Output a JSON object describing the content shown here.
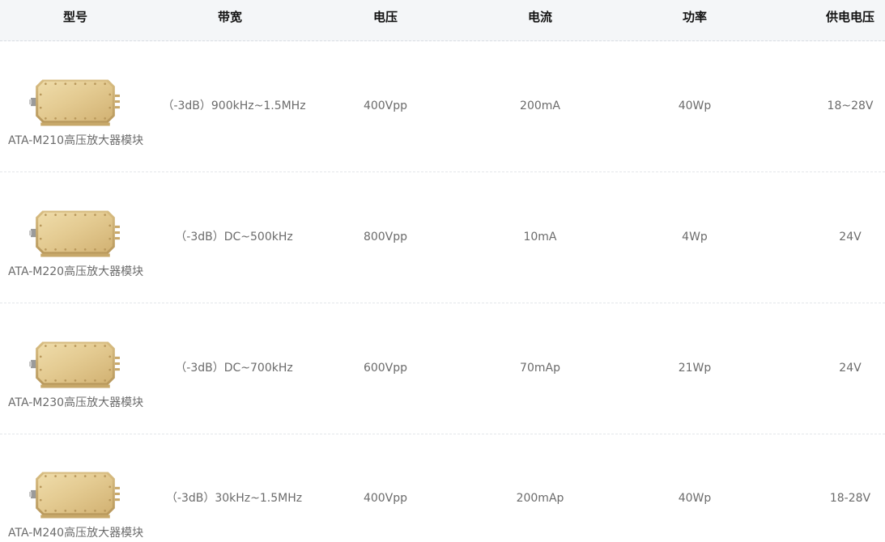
{
  "headers": [
    "型号",
    "带宽",
    "电压",
    "电流",
    "功率",
    "供电电压"
  ],
  "rows": [
    {
      "model": "ATA-M210高压放大器模块",
      "bandwidth": "（-3dB）900kHz~1.5MHz",
      "voltage": "400Vpp",
      "current": "200mA",
      "power": "40Wp",
      "supply": "18~28V"
    },
    {
      "model": "ATA-M220高压放大器模块",
      "bandwidth": "（-3dB）DC~500kHz",
      "voltage": "800Vpp",
      "current": "10mA",
      "power": "4Wp",
      "supply": "24V"
    },
    {
      "model": "ATA-M230高压放大器模块",
      "bandwidth": "（-3dB）DC~700kHz",
      "voltage": "600Vpp",
      "current": "70mAp",
      "power": "21Wp",
      "supply": "24V"
    },
    {
      "model": "ATA-M240高压放大器模块",
      "bandwidth": "（-3dB）30kHz~1.5MHz",
      "voltage": "400Vpp",
      "current": "200mAp",
      "power": "40Wp",
      "supply": "18-28V"
    }
  ],
  "colors": {
    "header_bg": "#f4f6f8",
    "header_text": "#111111",
    "cell_text": "#6b6b6b",
    "divider": "#e3e6ea",
    "module_gold": "#e2c98f"
  },
  "icons": {
    "product_image": "amplifier-module-icon"
  }
}
